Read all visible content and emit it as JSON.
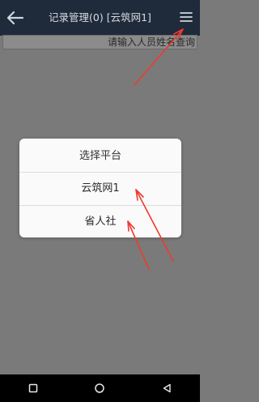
{
  "appbar": {
    "title": "记录管理(0) [云筑网1]"
  },
  "search": {
    "placeholder": "请输入人员姓名查询"
  },
  "dialog": {
    "title": "选择平台",
    "options": [
      "云筑网1",
      "省人社"
    ]
  },
  "colors": {
    "appbar_bg": "#1f2a3a",
    "dim_bg": "#7a7a7a",
    "dialog_bg": "#fafafa",
    "annotation_arrow": "#ef3a2f"
  },
  "icons": {
    "back": "back-arrow-icon",
    "menu": "menu-icon",
    "nav_square": "recent-apps-icon",
    "nav_circle": "home-icon",
    "nav_triangle": "back-triangle-icon"
  }
}
